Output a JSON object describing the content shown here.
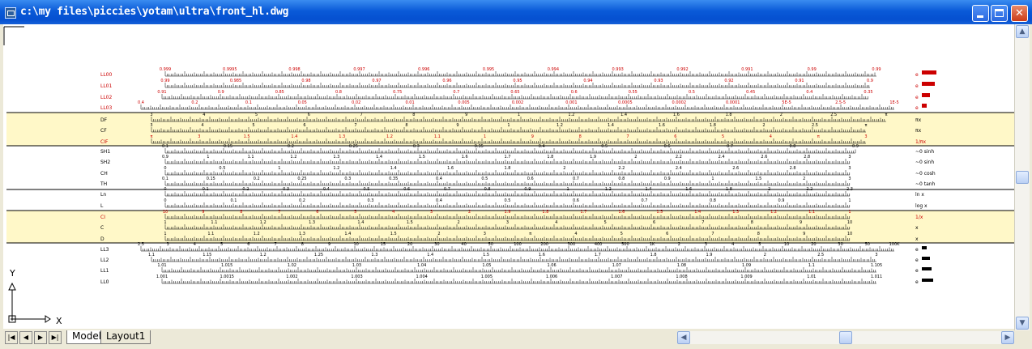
{
  "window": {
    "title": "c:\\my files\\piccies\\yotam\\ultra\\front_hl.dwg"
  },
  "icons": [
    "autocad-drawing-icon",
    "minimize-icon",
    "maximize-icon",
    "close-icon",
    "ucs-icon",
    "scroll-up-icon",
    "scroll-down-icon",
    "scroll-left-icon",
    "scroll-right-icon",
    "tab-first-icon",
    "tab-prev-icon",
    "tab-next-icon",
    "tab-last-icon"
  ],
  "colors": {
    "title_bar": "#0A5AD8",
    "band_fill": "#FFF8C8",
    "red_scale": "#CC0000",
    "canvas": "#FFFFFF",
    "chrome": "#ECE9D8"
  },
  "ucs": {
    "x_label": "X",
    "y_label": "Y"
  },
  "tabs": {
    "model": "Model",
    "layout1": "Layout1"
  },
  "scales": [
    {
      "name": "LL00",
      "color": "red",
      "marks": [
        "0.999",
        "0.9995",
        "0.998",
        "0.997",
        "0.996",
        "0.995",
        "0.994",
        "0.993",
        "0.992",
        "0.991",
        "0.99",
        "0.99"
      ],
      "right": "e"
    },
    {
      "name": "LL01",
      "color": "red",
      "marks": [
        "0.99",
        "0.985",
        "0.98",
        "0.97",
        "0.96",
        "0.95",
        "0.94",
        "0.93",
        "0.92",
        "0.91",
        "0.9"
      ],
      "right": "e"
    },
    {
      "name": "LL02",
      "color": "red",
      "marks": [
        "0.91",
        "0.9",
        "0.85",
        "0.8",
        "0.75",
        "0.7",
        "0.65",
        "0.6",
        "0.55",
        "0.5",
        "0.45",
        "0.4",
        "0.35"
      ],
      "right": "e"
    },
    {
      "name": "LL03",
      "color": "red",
      "marks": [
        "0.4",
        "0.2",
        "0.1",
        "0.05",
        "0.02",
        "0.01",
        "0.005",
        "0.002",
        "0.001",
        "0.0005",
        "0.0002",
        "0.0001",
        "5E-5",
        "2.5-5",
        "1E-5"
      ],
      "right": "e"
    },
    {
      "name": "DF",
      "color": "black",
      "marks": [
        "3",
        "4",
        "5",
        "6",
        "7",
        "8",
        "9",
        "1",
        "1.2",
        "1.4",
        "1.6",
        "1.8",
        "2",
        "2.5",
        "π"
      ],
      "right": "πx"
    },
    {
      "name": "CF",
      "color": "black",
      "marks": [
        "3",
        "4",
        "5",
        "6",
        "7",
        "8",
        "9",
        "1",
        "1.2",
        "1.4",
        "1.6",
        "1.8",
        "2",
        "2.5",
        "π"
      ],
      "right": "πx"
    },
    {
      "name": "CIF",
      "color": "red",
      "marks": [
        "π",
        "3",
        "1.5",
        "1.4",
        "1.3",
        "1.2",
        "1.1",
        "1",
        "9",
        "8",
        "7",
        "6",
        "5",
        "4",
        "π",
        "3"
      ],
      "right": "1/πx"
    },
    {
      "name": "SH1",
      "color": "black",
      "marks": [
        "0.1",
        "0.15",
        "0.2",
        "0.25",
        "0.3",
        "0.35",
        "0.4",
        "0.5",
        "0.6",
        "0.7",
        "0.8",
        "0.9"
      ],
      "right": "~0 sinh"
    },
    {
      "name": "SH2",
      "color": "black",
      "marks": [
        "0.9",
        "1",
        "1.1",
        "1.2",
        "1.3",
        "1.4",
        "1.5",
        "1.6",
        "1.7",
        "1.8",
        "1.9",
        "2",
        "2.2",
        "2.4",
        "2.6",
        "2.8",
        "3"
      ],
      "right": "~0 sinh"
    },
    {
      "name": "CH",
      "color": "black",
      "marks": [
        "0",
        "0.5",
        "1",
        "1.2",
        "1.4",
        "1.6",
        "1.8",
        "2",
        "2.2",
        "2.4",
        "2.6",
        "2.8",
        "3"
      ],
      "right": "~0 cosh"
    },
    {
      "name": "TH",
      "color": "black",
      "marks": [
        "0.1",
        "0.15",
        "0.2",
        "0.25",
        "0.3",
        "0.35",
        "0.4",
        "0.5",
        "0.6",
        "0.7",
        "0.8",
        "0.9",
        "1",
        "1.5",
        "2",
        "3"
      ],
      "right": "~0 tanh"
    },
    {
      "name": "Ln",
      "color": "black",
      "marks": [
        "0",
        "0.1",
        "0.2",
        "0.3",
        "0.4",
        "0.5",
        "0.6",
        "0.7",
        "0.8",
        "0.9",
        "1",
        "1.2",
        "1.4",
        "1.6",
        "1.8",
        "2",
        "2.2",
        "2.3"
      ],
      "right": "ln x"
    },
    {
      "name": "L",
      "color": "black",
      "marks": [
        "0",
        "0.1",
        "0.2",
        "0.3",
        "0.4",
        "0.5",
        "0.6",
        "0.7",
        "0.8",
        "0.9",
        "1"
      ],
      "right": "log x"
    },
    {
      "name": "CI",
      "color": "red",
      "marks": [
        "10",
        "9",
        "8",
        "7",
        "6",
        "5",
        "4",
        "3",
        "2",
        "1.9",
        "1.8",
        "1.7",
        "1.6",
        "1.5",
        "1.4",
        "1.3",
        "1.2",
        "1.1",
        "1"
      ],
      "right": "1/x"
    },
    {
      "name": "C",
      "color": "black",
      "marks": [
        "1",
        "1.1",
        "1.2",
        "1.3",
        "1.4",
        "1.5",
        "2",
        "3",
        "4",
        "5",
        "6",
        "7",
        "8",
        "9",
        "10"
      ],
      "right": "x"
    },
    {
      "name": "D",
      "color": "black",
      "marks": [
        "1",
        "1.1",
        "1.2",
        "1.3",
        "1.4",
        "1.5",
        "2",
        "3",
        "π",
        "4",
        "5",
        "6",
        "7",
        "8",
        "9",
        "10"
      ],
      "right": "x"
    },
    {
      "name": "LL3",
      "color": "black",
      "marks": [
        "2.5",
        "3",
        "4",
        "5",
        "6",
        "7",
        "8",
        "9",
        "10",
        "15",
        "20",
        "30",
        "40",
        "50",
        "100",
        "200",
        "300",
        "400",
        "500",
        "1K",
        "2",
        "3",
        "4",
        "5",
        "10",
        "20",
        "30",
        "50",
        "100K"
      ],
      "right": "e"
    },
    {
      "name": "LL2",
      "color": "black",
      "marks": [
        "1.1",
        "1.15",
        "1.2",
        "1.25",
        "1.3",
        "1.4",
        "1.5",
        "1.6",
        "1.7",
        "1.8",
        "1.9",
        "2",
        "2.5",
        "3"
      ],
      "right": "e"
    },
    {
      "name": "LL1",
      "color": "black",
      "marks": [
        "1.01",
        "1.015",
        "1.02",
        "1.03",
        "1.04",
        "1.05",
        "1.06",
        "1.07",
        "1.08",
        "1.09",
        "1.1",
        "1.105"
      ],
      "right": "e"
    },
    {
      "name": "LL0",
      "color": "black",
      "marks": [
        "1.001",
        "1.0015",
        "1.002",
        "1.003",
        "1.004",
        "1.005",
        "1.006",
        "1.007",
        "1.008",
        "1.009",
        "1.01",
        "1.011"
      ],
      "right": "e"
    }
  ]
}
